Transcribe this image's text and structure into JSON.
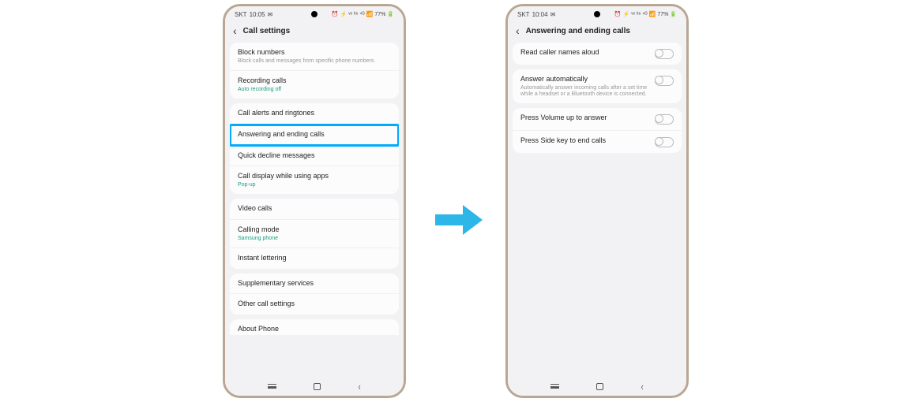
{
  "status": {
    "carrier": "SKT",
    "time_left": "10:05",
    "time_right": "10:04",
    "msg_icon": "✉",
    "right_icons": "⏰ ⚡ ᵛᵒ ˡᵗᵉ ⁴ᴳ 📶 77% 🔋"
  },
  "left_screen": {
    "header": "Call settings",
    "groups": [
      [
        {
          "title": "Block numbers",
          "sub": "Block calls and messages from specific phone numbers."
        },
        {
          "title": "Recording calls",
          "sub": "Auto recording off",
          "green": true
        }
      ],
      [
        {
          "title": "Call alerts and ringtones"
        },
        {
          "title": "Answering and ending calls",
          "highlight": true
        },
        {
          "title": "Quick decline messages"
        },
        {
          "title": "Call display while using apps",
          "sub": "Pop-up",
          "green": true
        }
      ],
      [
        {
          "title": "Video calls"
        },
        {
          "title": "Calling mode",
          "sub": "Samsung phone",
          "green": true
        },
        {
          "title": "Instant lettering"
        }
      ],
      [
        {
          "title": "Supplementary services"
        },
        {
          "title": "Other call settings"
        }
      ]
    ],
    "partial": "About Phone"
  },
  "right_screen": {
    "header": "Answering and ending calls",
    "groups": [
      [
        {
          "title": "Read caller names aloud",
          "toggle": true
        }
      ],
      [
        {
          "title": "Answer automatically",
          "sub": "Automatically answer incoming calls after a set time while a headset or a Bluetooth device is connected.",
          "toggle": true
        }
      ],
      [
        {
          "title": "Press Volume up to answer",
          "toggle": true
        },
        {
          "title": "Press Side key to end calls",
          "toggle": true
        }
      ]
    ]
  }
}
